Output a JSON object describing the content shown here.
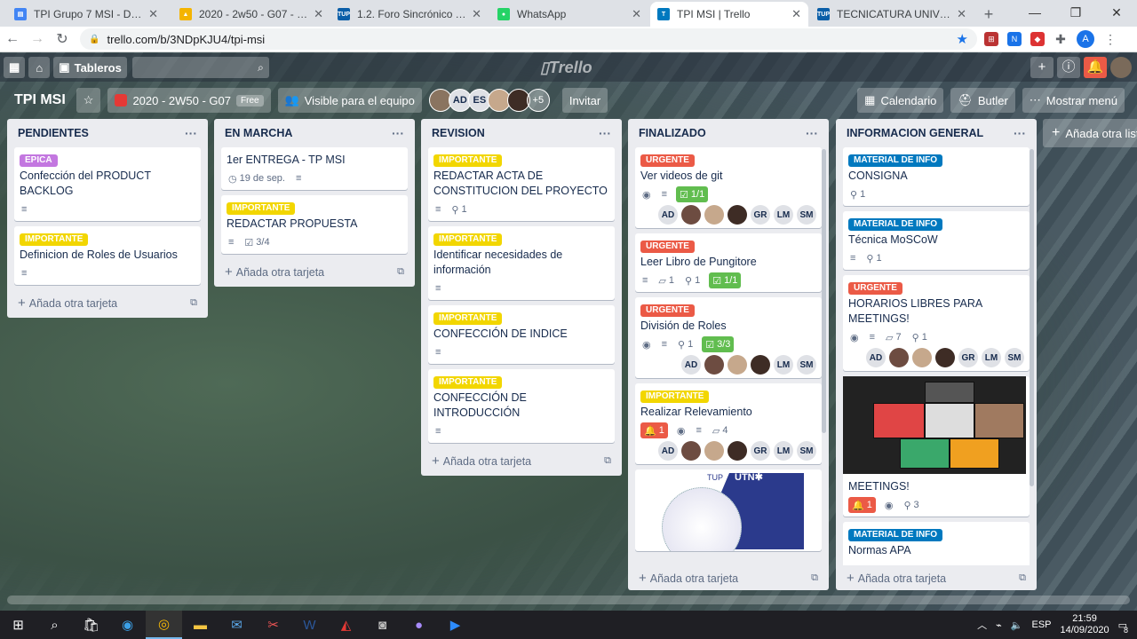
{
  "browser": {
    "tabs": [
      {
        "title": "TPI Grupo 7 MSI - Document",
        "color": "#4285f4",
        "glyph": "▤"
      },
      {
        "title": "2020 - 2w50 - G07 - Google",
        "color": "#f4b400",
        "glyph": "▲"
      },
      {
        "title": "1.2. Foro Sincrónico TURNO",
        "color": "#0a5ea8",
        "glyph": "TUP"
      },
      {
        "title": "WhatsApp",
        "color": "#25d366",
        "glyph": "●"
      },
      {
        "title": "TPI MSI | Trello",
        "color": "#0079bf",
        "glyph": "T"
      },
      {
        "title": "TECNICATURA UNIVERSITAR",
        "color": "#0a5ea8",
        "glyph": "TUP"
      }
    ],
    "active_tab": 4,
    "url": "trello.com/b/3NDpKJU4/tpi-msi",
    "profile_initial": "A",
    "new_tab": "+",
    "win_min": "—",
    "win_max": "❐",
    "win_close": "✕"
  },
  "trello_header": {
    "boards_label": "Tableros",
    "logo": "Trello"
  },
  "board": {
    "title": "TPI MSI",
    "team": "2020 - 2W50 - G07",
    "free": "Free",
    "visibility": "Visible para el equipo",
    "members": [
      "AD",
      "ES"
    ],
    "more_members": "+5",
    "invite": "Invitar",
    "calendar": "Calendario",
    "butler": "Butler",
    "menu": "Mostrar menú"
  },
  "lists": [
    {
      "name": "PENDIENTES",
      "cards": [
        {
          "label": "EPICA",
          "title": "Confección del PRODUCT BACKLOG",
          "desc": true
        },
        {
          "label": "IMPORTANTE",
          "title": "Definicion de Roles de Usuarios",
          "desc": true
        }
      ]
    },
    {
      "name": "EN MARCHA",
      "cards": [
        {
          "title": "1er ENTREGA - TP MSI",
          "due": "19 de sep.",
          "desc": true
        },
        {
          "label": "IMPORTANTE",
          "title": "REDACTAR PROPUESTA",
          "desc": true,
          "check": "3/4"
        }
      ]
    },
    {
      "name": "REVISION",
      "cards": [
        {
          "label": "IMPORTANTE",
          "title": "REDACTAR ACTA DE CONSTITUCION DEL PROYECTO",
          "desc": true,
          "attach": "1"
        },
        {
          "label": "IMPORTANTE",
          "title": "Identificar necesidades de información",
          "desc": true
        },
        {
          "label": "IMPORTANTE",
          "title": "CONFECCIÓN DE INDICE",
          "desc": true
        },
        {
          "label": "IMPORTANTE",
          "title": "CONFECCIÓN DE INTRODUCCIÓN",
          "desc": true
        }
      ]
    },
    {
      "name": "FINALIZADO",
      "cards": [
        {
          "label": "URGENTE",
          "title": "Ver videos de git",
          "watch": true,
          "desc": true,
          "check": "1/1",
          "check_done": true,
          "members": [
            "AD",
            "ph",
            "ph2",
            "ph3",
            "GR",
            "LM",
            "SM"
          ]
        },
        {
          "label": "URGENTE",
          "title": "Leer Libro de Pungitore",
          "desc": true,
          "comments": "1",
          "attach": "1",
          "check": "1/1",
          "check_done": true
        },
        {
          "label": "URGENTE",
          "title": "División de Roles",
          "watch": true,
          "desc": true,
          "attach": "1",
          "check": "3/3",
          "check_done": true,
          "members": [
            "AD",
            "ph",
            "ph2",
            "ph3",
            "LM",
            "SM"
          ]
        },
        {
          "label": "IMPORTANTE",
          "title": "Realizar Relevamiento",
          "notif": "1",
          "watch": true,
          "desc": true,
          "comments": "4",
          "members": [
            "AD",
            "ph",
            "ph2",
            "ph3",
            "GR",
            "LM",
            "SM"
          ]
        }
      ]
    },
    {
      "name": "INFORMACION GENERAL",
      "cards": [
        {
          "label": "MATERIAL DE INFO",
          "title": "CONSIGNA",
          "attach": "1"
        },
        {
          "label": "MATERIAL DE INFO",
          "title": "Técnica MoSCoW",
          "desc": true,
          "attach": "1"
        },
        {
          "label": "URGENTE",
          "title": "HORARIOS LIBRES PARA MEETINGS!",
          "watch": true,
          "desc": true,
          "comments": "7",
          "attach": "1",
          "members": [
            "AD",
            "ph",
            "ph2",
            "ph3",
            "GR",
            "LM",
            "SM"
          ]
        },
        {
          "title": "MEETINGS!",
          "cover": true,
          "notif": "1",
          "watch": true,
          "attach": "3"
        },
        {
          "label": "MATERIAL DE INFO",
          "title": "Normas APA",
          "desc": true
        }
      ]
    }
  ],
  "add_card": "Añada otra tarjeta",
  "add_list": "Añada otra lista",
  "utn_card": {
    "tup": "TUP",
    "utn": "UTN✱"
  },
  "taskbar": {
    "lang": "ESP",
    "time": "21:59",
    "date": "14/09/2020",
    "notif": "8"
  },
  "colors": {
    "epica": "#c377e0",
    "importante": "#f2d600",
    "urgente": "#eb5a46",
    "material": "#0079bf",
    "green": "#61bd4f"
  }
}
